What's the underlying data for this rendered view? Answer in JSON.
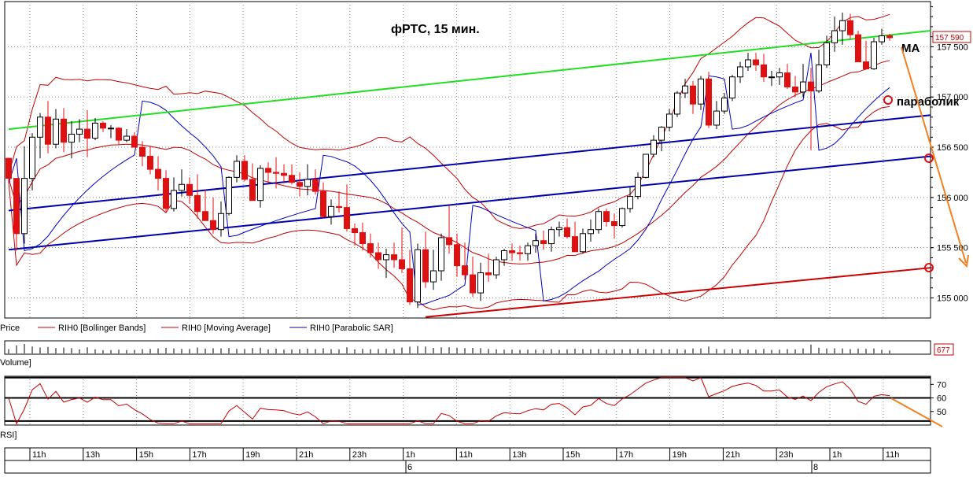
{
  "chart_data": {
    "type": "candlestick",
    "title": "фРТС,   15 мин.",
    "instrument": "RIH0",
    "timeframe": "15 мин.",
    "price_axis": {
      "ticks": [
        "157 500",
        "157 000",
        "156 500",
        "156 000",
        "155 500",
        "155 000"
      ],
      "tick_values": [
        157500,
        157000,
        156500,
        156000,
        155500,
        155000
      ],
      "range": [
        154800,
        157950
      ],
      "last_price_label": "157 590",
      "last_price": 157590
    },
    "time_axis": {
      "hour_labels": [
        "11h",
        "13h",
        "15h",
        "17h",
        "19h",
        "21h",
        "23h",
        "1h",
        "11h",
        "13h",
        "15h",
        "17h",
        "19h",
        "21h",
        "23h",
        "1h",
        "11h"
      ],
      "day_labels": [
        "6",
        "8"
      ]
    },
    "legend": [
      {
        "name": "Price"
      },
      {
        "name": "RIH0 [Bollinger Bands]",
        "color": "#c00000"
      },
      {
        "name": "RIH0 [Moving Average]",
        "color": "#c00000"
      },
      {
        "name": "RIH0 [Parabolic SAR]",
        "color": "#0000c0"
      }
    ],
    "volume": {
      "label": "Volume]",
      "last_label": "677",
      "last_value": 677
    },
    "rsi": {
      "label": "RSI]",
      "ticks": [
        "70",
        "60",
        "50"
      ],
      "tick_values": [
        70,
        60,
        50
      ],
      "range": [
        40,
        76
      ],
      "levels": [
        75,
        60,
        43
      ]
    },
    "annotations": [
      {
        "text": "MA"
      },
      {
        "text": "параболик"
      }
    ],
    "colors": {
      "up_candle": "#ffffff",
      "down_candle": "#e01010",
      "bollinger": "#c00000",
      "sar": "#0000c0",
      "green_line": "#22dd22",
      "blue_channel": "#0000aa",
      "red_trend": "#cc0000",
      "forecast_arrow": "#f08020"
    },
    "candles": [
      [
        156390,
        156390,
        156140,
        156190
      ],
      [
        156190,
        156190,
        155470,
        155640
      ],
      [
        155640,
        156510,
        155540,
        156190
      ],
      [
        156190,
        156640,
        156070,
        156600
      ],
      [
        156600,
        156840,
        156390,
        156800
      ],
      [
        156800,
        156960,
        156440,
        156530
      ],
      [
        156530,
        156880,
        156490,
        156780
      ],
      [
        156780,
        156890,
        156450,
        156550
      ],
      [
        156550,
        156760,
        156390,
        156630
      ],
      [
        156630,
        156780,
        156550,
        156680
      ],
      [
        156680,
        156870,
        156400,
        156590
      ],
      [
        156590,
        156790,
        156570,
        156740
      ],
      [
        156740,
        156760,
        156650,
        156690
      ],
      [
        156690,
        156720,
        156590,
        156690
      ],
      [
        156690,
        156700,
        156520,
        156570
      ],
      [
        156570,
        156680,
        156550,
        156610
      ],
      [
        156610,
        156650,
        156500,
        156500
      ],
      [
        156500,
        156560,
        156310,
        156410
      ],
      [
        156410,
        156510,
        156230,
        156280
      ],
      [
        156280,
        156410,
        156070,
        156190
      ],
      [
        156190,
        156270,
        155860,
        155890
      ],
      [
        155890,
        156200,
        155860,
        156070
      ],
      [
        156070,
        156280,
        156010,
        156130
      ],
      [
        156130,
        156200,
        155940,
        156020
      ],
      [
        156020,
        156230,
        155790,
        155860
      ],
      [
        155860,
        156080,
        155770,
        155770
      ],
      [
        155770,
        156000,
        155640,
        155680
      ],
      [
        155680,
        155960,
        155610,
        155840
      ],
      [
        155840,
        156210,
        155820,
        156200
      ],
      [
        156200,
        156420,
        156150,
        156360
      ],
      [
        156360,
        156420,
        156160,
        156180
      ],
      [
        156180,
        156340,
        155970,
        155970
      ],
      [
        155970,
        156320,
        155900,
        156290
      ],
      [
        156290,
        156350,
        156140,
        156250
      ],
      [
        156250,
        156400,
        156090,
        156240
      ],
      [
        156240,
        156330,
        156140,
        156220
      ],
      [
        156220,
        156330,
        156130,
        156150
      ],
      [
        156150,
        156250,
        156010,
        156110
      ],
      [
        156110,
        156330,
        156020,
        156180
      ],
      [
        156180,
        156280,
        156030,
        156060
      ],
      [
        156060,
        156150,
        155800,
        155810
      ],
      [
        155810,
        155980,
        155730,
        155910
      ],
      [
        155910,
        156060,
        155850,
        155900
      ],
      [
        155900,
        156130,
        155660,
        155690
      ],
      [
        155690,
        155740,
        155520,
        155650
      ],
      [
        155650,
        155750,
        155470,
        155540
      ],
      [
        155540,
        155640,
        155400,
        155450
      ],
      [
        155450,
        155550,
        155290,
        155380
      ],
      [
        155380,
        155490,
        155200,
        155430
      ],
      [
        155430,
        155550,
        155300,
        155380
      ],
      [
        155380,
        155700,
        155250,
        155290
      ],
      [
        155290,
        155480,
        154930,
        154960
      ],
      [
        154960,
        155540,
        154900,
        155480
      ],
      [
        155480,
        155660,
        155100,
        155160
      ],
      [
        155160,
        155480,
        155080,
        155270
      ],
      [
        155270,
        155640,
        155170,
        155600
      ],
      [
        155600,
        155920,
        155440,
        155530
      ],
      [
        155530,
        155640,
        155210,
        155320
      ],
      [
        155320,
        155550,
        155180,
        155230
      ],
      [
        155230,
        155410,
        155010,
        155050
      ],
      [
        155050,
        155350,
        154970,
        155250
      ],
      [
        155250,
        155440,
        155160,
        155230
      ],
      [
        155230,
        155410,
        155190,
        155380
      ],
      [
        155380,
        155490,
        155320,
        155470
      ],
      [
        155470,
        155540,
        155370,
        155450
      ],
      [
        155450,
        155520,
        155370,
        155440
      ],
      [
        155440,
        155550,
        155370,
        155520
      ],
      [
        155520,
        155640,
        155450,
        155570
      ],
      [
        155570,
        155670,
        155480,
        155540
      ],
      [
        155540,
        155710,
        155460,
        155680
      ],
      [
        155680,
        155760,
        155610,
        155700
      ],
      [
        155700,
        155790,
        155590,
        155610
      ],
      [
        155610,
        155760,
        155460,
        155460
      ],
      [
        155460,
        155690,
        155440,
        155640
      ],
      [
        155640,
        155780,
        155560,
        155680
      ],
      [
        155680,
        155890,
        155640,
        155860
      ],
      [
        155860,
        155890,
        155710,
        155760
      ],
      [
        155760,
        155840,
        155590,
        155720
      ],
      [
        155720,
        155900,
        155700,
        155890
      ],
      [
        155890,
        156100,
        155850,
        156010
      ],
      [
        156010,
        156250,
        155980,
        156200
      ],
      [
        156200,
        156430,
        156190,
        156430
      ],
      [
        156430,
        156620,
        156400,
        156570
      ],
      [
        156570,
        156710,
        156460,
        156700
      ],
      [
        156700,
        156880,
        156660,
        156830
      ],
      [
        156830,
        157060,
        156800,
        157040
      ],
      [
        157040,
        157180,
        156990,
        157110
      ],
      [
        157110,
        157160,
        156830,
        156930
      ],
      [
        156930,
        157210,
        156870,
        157180
      ],
      [
        157180,
        157250,
        156690,
        156720
      ],
      [
        156720,
        156960,
        156680,
        156860
      ],
      [
        156860,
        157040,
        156830,
        156990
      ],
      [
        156990,
        157220,
        156960,
        157200
      ],
      [
        157200,
        157350,
        157140,
        157300
      ],
      [
        157300,
        157440,
        157260,
        157370
      ],
      [
        157370,
        157440,
        157260,
        157320
      ],
      [
        157320,
        157430,
        157150,
        157200
      ],
      [
        157200,
        157260,
        157110,
        157200
      ],
      [
        157200,
        157290,
        157120,
        157240
      ],
      [
        157240,
        157330,
        157080,
        157100
      ],
      [
        157100,
        157210,
        157000,
        157050
      ],
      [
        157050,
        157330,
        157000,
        157150
      ],
      [
        157150,
        157290,
        156470,
        157060
      ],
      [
        157060,
        157470,
        157040,
        157320
      ],
      [
        157320,
        157610,
        157290,
        157540
      ],
      [
        157540,
        157800,
        157450,
        157660
      ],
      [
        157660,
        157840,
        157520,
        157760
      ],
      [
        157760,
        157830,
        157580,
        157620
      ],
      [
        157620,
        157660,
        157350,
        157350
      ],
      [
        157350,
        157560,
        157270,
        157280
      ],
      [
        157280,
        157590,
        157270,
        157550
      ],
      [
        157550,
        157680,
        157520,
        157610
      ],
      [
        157610,
        157630,
        157560,
        157590
      ]
    ]
  }
}
